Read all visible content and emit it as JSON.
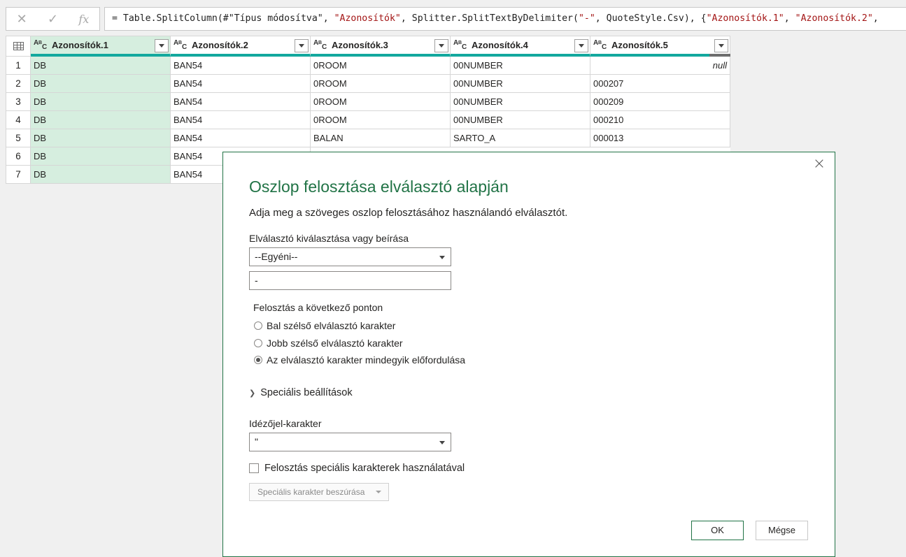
{
  "formula_bar": {
    "cancel_icon": "✕",
    "commit_icon": "✓",
    "fx_icon": "fx",
    "formula_parts": [
      {
        "text": "= Table.SplitColumn(#\"Típus módosítva\", ",
        "kind": "code"
      },
      {
        "text": "\"Azonosítók\"",
        "kind": "str"
      },
      {
        "text": ", Splitter.SplitTextByDelimiter(",
        "kind": "code"
      },
      {
        "text": "\"-\"",
        "kind": "str"
      },
      {
        "text": ", QuoteStyle.Csv), {",
        "kind": "code"
      },
      {
        "text": "\"Azonosítók.1\"",
        "kind": "str"
      },
      {
        "text": ", ",
        "kind": "code"
      },
      {
        "text": "\"Azonosítók.2\"",
        "kind": "str"
      },
      {
        "text": ",",
        "kind": "code"
      }
    ]
  },
  "grid": {
    "type_icon": "ABC",
    "columns": [
      "Azonosítók.1",
      "Azonosítók.2",
      "Azonosítók.3",
      "Azonosítók.4",
      "Azonosítók.5"
    ],
    "rows": [
      {
        "num": "1",
        "cells": [
          "DB",
          "BAN54",
          "0ROOM",
          "00NUMBER",
          "null"
        ]
      },
      {
        "num": "2",
        "cells": [
          "DB",
          "BAN54",
          "0ROOM",
          "00NUMBER",
          "000207"
        ]
      },
      {
        "num": "3",
        "cells": [
          "DB",
          "BAN54",
          "0ROOM",
          "00NUMBER",
          "000209"
        ]
      },
      {
        "num": "4",
        "cells": [
          "DB",
          "BAN54",
          "0ROOM",
          "00NUMBER",
          "000210"
        ]
      },
      {
        "num": "5",
        "cells": [
          "DB",
          "BAN54",
          "BALAN",
          "SARTO_A",
          "000013"
        ]
      },
      {
        "num": "6",
        "cells": [
          "DB",
          "BAN54"
        ]
      },
      {
        "num": "7",
        "cells": [
          "DB",
          "BAN54"
        ]
      }
    ]
  },
  "dialog": {
    "title": "Oszlop felosztása elválasztó alapján",
    "subtitle": "Adja meg a szöveges oszlop felosztásához használandó elválasztót.",
    "delimiter_label": "Elválasztó kiválasztása vagy beírása",
    "delimiter_select_value": "--Egyéni--",
    "delimiter_text_value": "-",
    "split_at_label": "Felosztás a következő ponton",
    "split_options": [
      {
        "label": "Bal szélső elválasztó karakter",
        "checked": false
      },
      {
        "label": "Jobb szélső elválasztó karakter",
        "checked": false
      },
      {
        "label": "Az elválasztó karakter mindegyik előfordulása",
        "checked": true
      }
    ],
    "advanced_label": "Speciális beállítások",
    "quote_label": "Idézőjel-karakter",
    "quote_value": "\"",
    "special_chars_label": "Felosztás speciális karakterek használatával",
    "insert_special_label": "Speciális karakter beszúrása",
    "ok_label": "OK",
    "cancel_label": "Mégse",
    "close_icon": "×"
  },
  "colors": {
    "accent_green": "#217346",
    "column_quality_bar": "#13a89e",
    "selected_column": "#d6eedf"
  }
}
